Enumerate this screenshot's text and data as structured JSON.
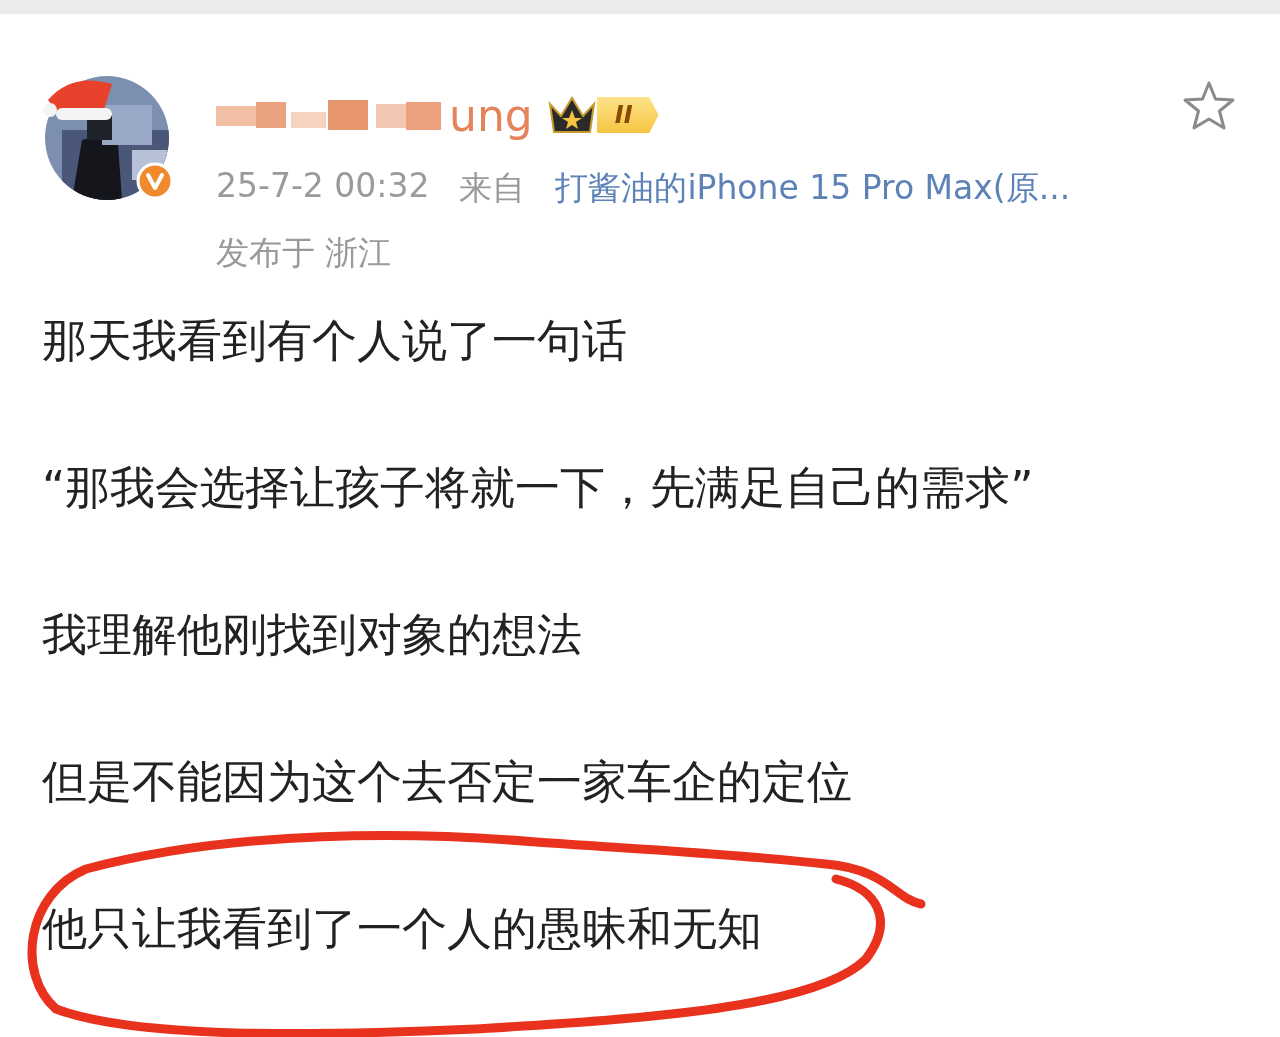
{
  "post": {
    "author": {
      "name": "ung",
      "level_badge": "II",
      "verified": true
    },
    "time": "25-7-2 00:32",
    "source_label": "来自",
    "source": "打酱油的iPhone 15 Pro Max(原...",
    "location": "发布于 浙江",
    "favorited": false,
    "paragraphs": [
      "那天我看到有个人说了一句话",
      "“那我会选择让孩子将就一下，先满足自己的需求”",
      "我理解他刚找到对象的想法",
      "但是不能因为这个去否定一家车企的定位",
      "他只让我看到了一个人的愚昧和无知"
    ],
    "annotation": {
      "color": "#e8321e"
    }
  }
}
